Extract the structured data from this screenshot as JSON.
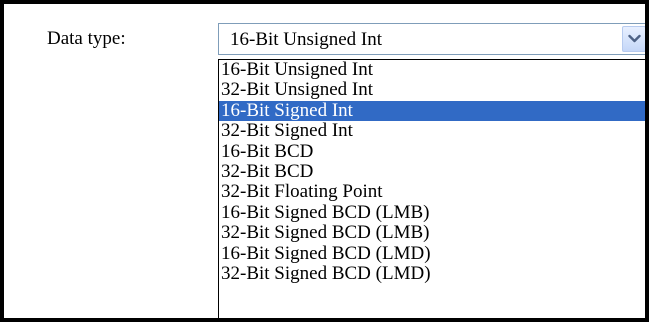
{
  "field": {
    "label": "Data type:",
    "selected_value": "16-Bit Unsigned Int"
  },
  "dropdown": {
    "options": [
      "16-Bit Unsigned Int",
      "32-Bit Unsigned Int",
      "16-Bit Signed Int",
      "32-Bit Signed Int",
      "16-Bit BCD",
      "32-Bit BCD",
      "32-Bit Floating Point",
      "16-Bit Signed BCD (LMB)",
      "32-Bit Signed BCD (LMB)",
      "16-Bit Signed BCD (LMD)",
      "32-Bit Signed BCD (LMD)"
    ],
    "highlighted_index": 2
  },
  "colors": {
    "highlight": "#316ac5",
    "border": "#7f9db9"
  },
  "icons": {
    "dropdown_arrow": "chevron-down-icon"
  }
}
